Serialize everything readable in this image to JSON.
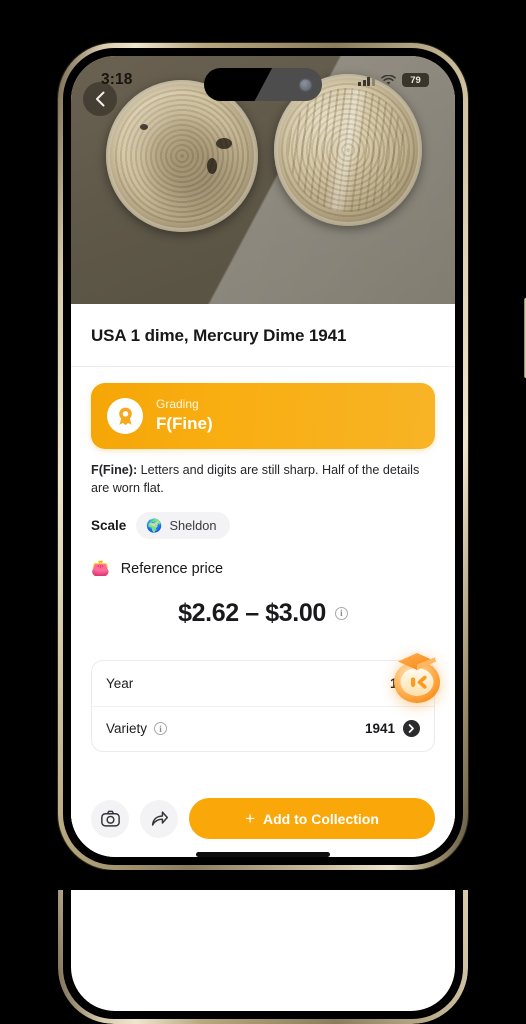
{
  "status_bar": {
    "time": "3:18",
    "battery_percent": "79",
    "signal_icon": "cellular-bars-icon",
    "wifi_icon": "wifi-icon",
    "battery_icon": "battery-icon"
  },
  "hero": {
    "back_icon": "chevron-left-icon",
    "photo_alt": "mercury-dime-obverse-and-reverse"
  },
  "page": {
    "title": "USA 1 dime, Mercury Dime 1941"
  },
  "grading": {
    "icon": "award-medal-icon",
    "label": "Grading",
    "value": "F(Fine)",
    "description_term": "F(Fine):",
    "description_text": " Letters and digits are still sharp. Half of the details are worn flat."
  },
  "scale": {
    "label": "Scale",
    "pill_icon": "globe-icon",
    "pill_value": "Sheldon"
  },
  "reference_price": {
    "icon": "wallet-icon",
    "title": "Reference price",
    "value": "$2.62 – $3.00",
    "info_icon": "info-circle-icon",
    "info_glyph": "i"
  },
  "details": {
    "rows": [
      {
        "key": "Year",
        "value": "1941",
        "has_info": false,
        "has_chevron": false
      },
      {
        "key": "Variety",
        "value": "1941",
        "has_info": true,
        "has_chevron": true
      }
    ],
    "info_icon": "info-circle-icon",
    "chevron_icon": "chevron-right-icon"
  },
  "mascot": {
    "icon": "assistant-mascot-icon"
  },
  "bottom_bar": {
    "camera_icon": "camera-icon",
    "share_icon": "share-arrow-icon",
    "cta_plus": "+",
    "cta_label": "Add to Collection"
  },
  "colors": {
    "accent": "#faa70a",
    "grade_gradient_start": "#f5a607",
    "grade_gradient_end": "#f8b426",
    "wallet_orange": "#ff8f5a",
    "text_primary": "#19191c",
    "chip_bg": "#f3f3f5"
  }
}
